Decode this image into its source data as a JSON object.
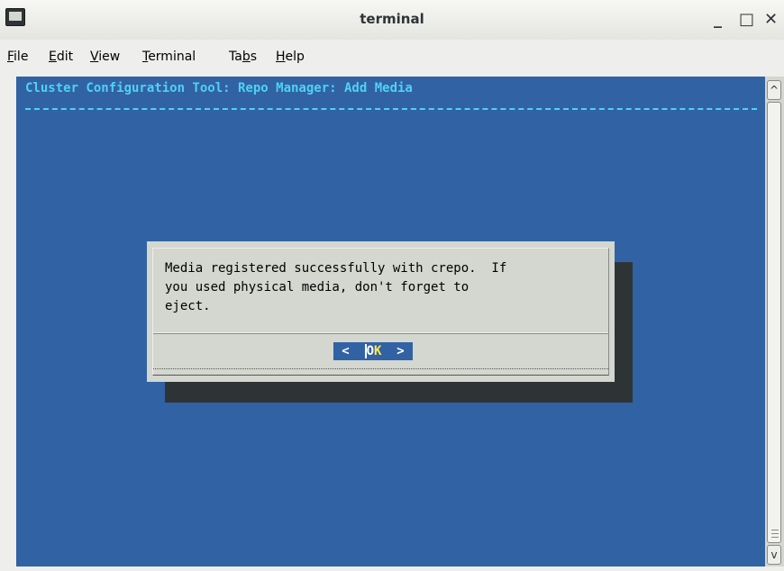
{
  "window": {
    "title": "terminal",
    "minimize_label": "_",
    "maximize_label": "□",
    "close_label": "✕"
  },
  "menubar": {
    "items": [
      {
        "label_pre": "",
        "mnemonic": "F",
        "label_post": "ile"
      },
      {
        "label_pre": "",
        "mnemonic": "E",
        "label_post": "dit"
      },
      {
        "label_pre": "",
        "mnemonic": "V",
        "label_post": "iew"
      },
      {
        "label_pre": "",
        "mnemonic": "T",
        "label_post": "erminal"
      },
      {
        "label_pre": "Ta",
        "mnemonic": "b",
        "label_post": "s"
      },
      {
        "label_pre": "",
        "mnemonic": "H",
        "label_post": "elp"
      }
    ]
  },
  "terminal": {
    "header": "Cluster Configuration Tool: Repo Manager: Add Media",
    "dialog": {
      "message": "Media registered successfully with crepo.  If\nyou used physical media, don't forget to\neject.",
      "ok_left": "<  ",
      "ok_cursor": "O",
      "ok_hot": "K",
      "ok_right": "  >"
    }
  },
  "scrollbar": {
    "up_icon": "^",
    "down_icon": "v"
  },
  "colors": {
    "terminal_bg": "#3162a4",
    "header_fg": "#4fd2f2",
    "dialog_bg": "#d3d7cf",
    "shadow": "#2e3436",
    "hotkey": "#fce94f"
  }
}
